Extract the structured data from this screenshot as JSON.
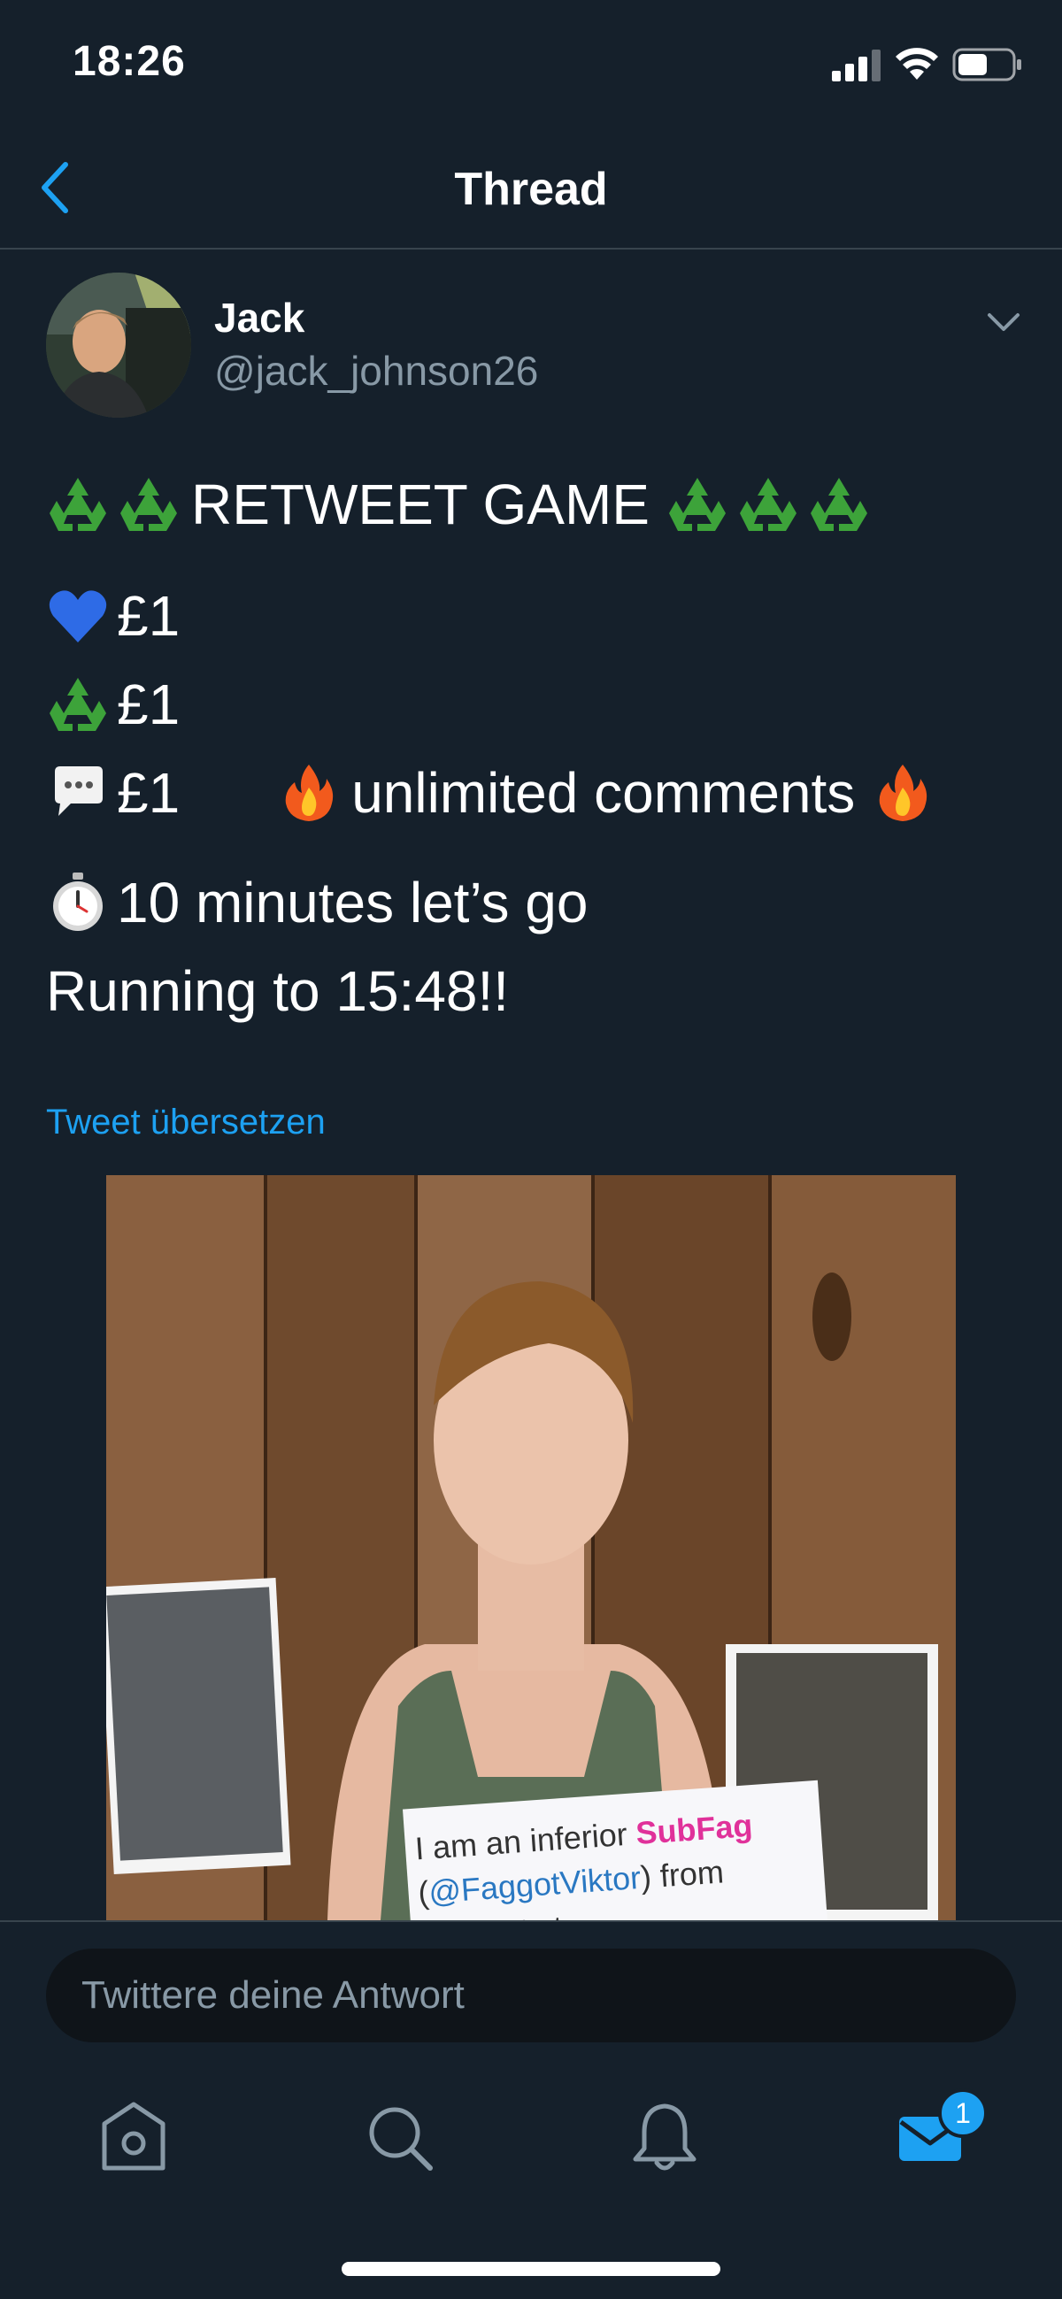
{
  "status_bar": {
    "time": "18:26"
  },
  "nav": {
    "title": "Thread"
  },
  "tweet": {
    "author_name": "Jack",
    "author_handle": "@jack_johnson26",
    "line1_text": "RETWEET GAME",
    "line_like": "£1",
    "line_retweet": "£1",
    "line_comment": "£1",
    "line_comment_extra": "unlimited comments",
    "line_timer": "10 minutes let’s go",
    "line_running": "Running to 15:48!!",
    "translate_label": "Tweet übersetzen"
  },
  "media": {
    "sign_line1_prefix": "I am an inferior ",
    "sign_line1_highlight": "SubFag",
    "sign_line2_open": "(",
    "sign_line2_mention": "@FaggotViktor",
    "sign_line2_rest": ") from",
    "sign_line3": "… wants to"
  },
  "reply": {
    "placeholder": "Twittere deine Antwort"
  },
  "tabs": {
    "messages_badge": "1"
  },
  "colors": {
    "accent": "#1da1f2",
    "background": "#15202b",
    "secondary_text": "#8899a6",
    "recycle_green": "#3da33a"
  }
}
